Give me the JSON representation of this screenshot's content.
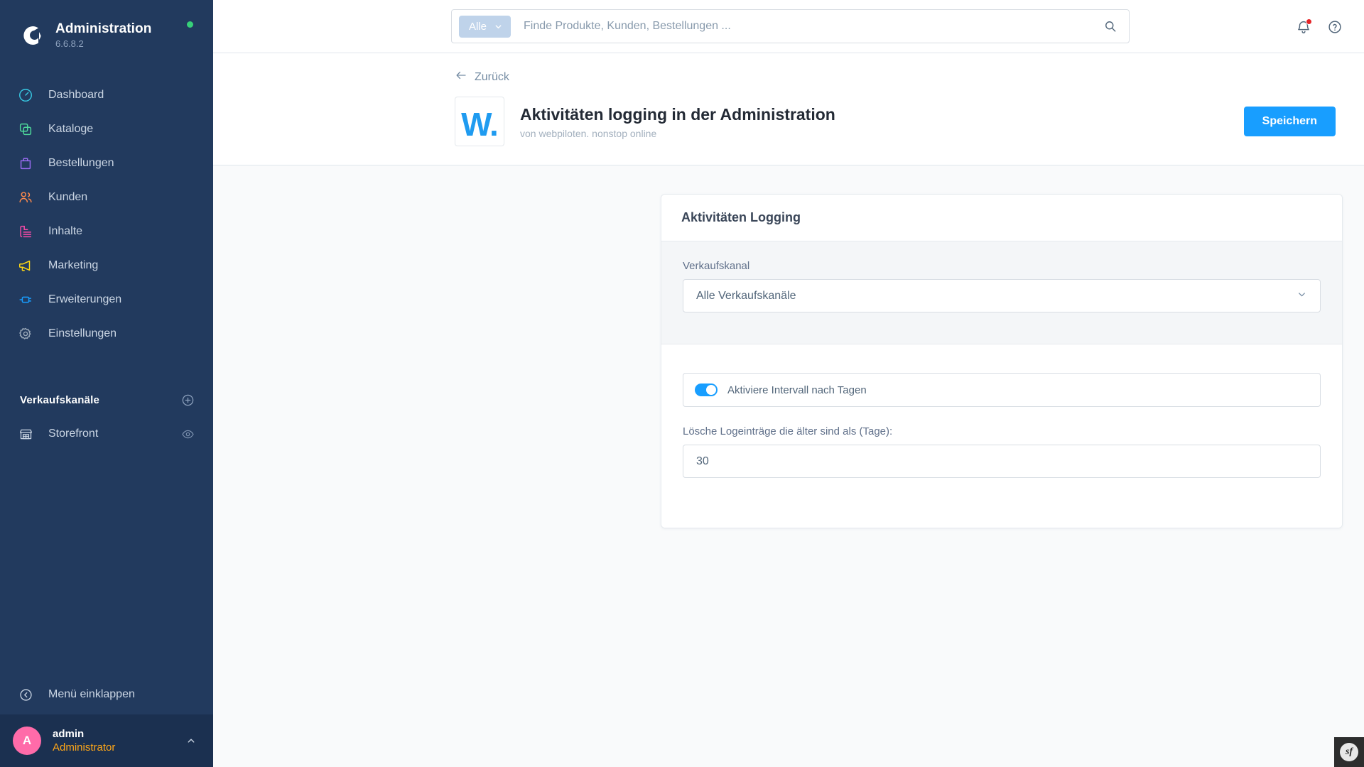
{
  "sidebar": {
    "brand": {
      "title": "Administration",
      "version": "6.6.8.2",
      "logo_icon": "shopware-logo-icon",
      "status_icon": "status-dot-icon"
    },
    "items": [
      {
        "label": "Dashboard",
        "icon": "dashboard-icon",
        "color": "#37C6E0"
      },
      {
        "label": "Kataloge",
        "icon": "catalog-icon",
        "color": "#4ED99B"
      },
      {
        "label": "Bestellungen",
        "icon": "orders-icon",
        "color": "#9B6CF2"
      },
      {
        "label": "Kunden",
        "icon": "customers-icon",
        "color": "#FF8A4C"
      },
      {
        "label": "Inhalte",
        "icon": "content-icon",
        "color": "#F94BA8"
      },
      {
        "label": "Marketing",
        "icon": "marketing-icon",
        "color": "#FFD814"
      },
      {
        "label": "Erweiterungen",
        "icon": "extensions-icon",
        "color": "#189EFF"
      },
      {
        "label": "Einstellungen",
        "icon": "settings-icon",
        "color": "#9AA8B8"
      }
    ],
    "sales_channels": {
      "heading": "Verkaufskanäle",
      "add_icon": "plus-circle-icon",
      "items": [
        {
          "label": "Storefront",
          "icon": "storefront-icon",
          "action_icon": "eye-icon"
        }
      ]
    },
    "collapse": {
      "label": "Menü einklappen",
      "icon": "collapse-left-icon"
    },
    "user": {
      "avatar_initial": "A",
      "name": "admin",
      "role": "Administrator",
      "caret_icon": "chevron-up-icon"
    }
  },
  "topbar": {
    "search": {
      "scope_label": "Alle",
      "scope_caret_icon": "chevron-down-icon",
      "placeholder": "Finde Produkte, Kunden, Bestellungen ...",
      "value": "",
      "search_icon": "search-icon"
    },
    "notifications_icon": "bell-icon",
    "notifications_badge": "",
    "help_icon": "help-circle-icon"
  },
  "page_header": {
    "back_label": "Zurück",
    "back_icon": "arrow-left-icon",
    "plugin_logo_text": "W.",
    "title": "Aktivitäten logging in der Administration",
    "subtitle": "von webpiloten. nonstop online",
    "save_label": "Speichern"
  },
  "card": {
    "title": "Aktivitäten Logging",
    "sales_channel": {
      "label": "Verkaufskanal",
      "value": "Alle Verkaufskanäle",
      "caret_icon": "chevron-down-icon"
    },
    "interval_toggle": {
      "label": "Aktiviere Intervall nach Tagen",
      "enabled": true
    },
    "retention": {
      "label": "Lösche Logeinträge die älter sind als (Tage):",
      "value": "30"
    }
  },
  "debug_toolbar": {
    "label": "sf",
    "icon": "symfony-icon"
  },
  "colors": {
    "sidebar_bg": "#223A5E",
    "accent_blue": "#189EFF",
    "status_green": "#37D079",
    "avatar_pink": "#FF6BA9",
    "role_orange": "#FFA718",
    "badge_red": "#E52427"
  }
}
